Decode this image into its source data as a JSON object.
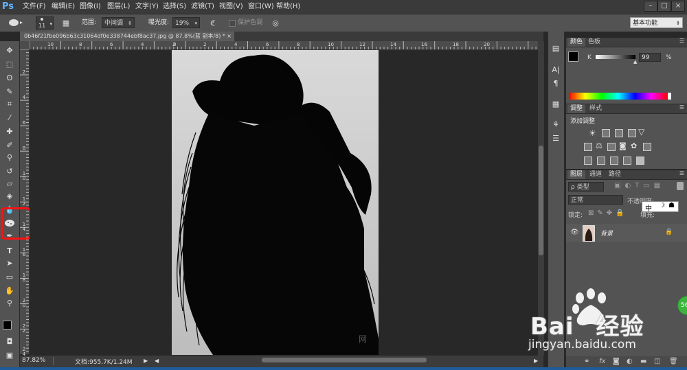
{
  "app": {
    "logo": "Ps"
  },
  "menu": [
    "文件(F)",
    "编辑(E)",
    "图像(I)",
    "图层(L)",
    "文字(Y)",
    "选择(S)",
    "滤镜(T)",
    "视图(V)",
    "窗口(W)",
    "帮助(H)"
  ],
  "window_buttons": [
    "–",
    "□",
    "×"
  ],
  "options": {
    "brush_size": "11",
    "range_label": "范围:",
    "range_value": "中间调",
    "exposure_label": "曝光度:",
    "exposure_value": "19%",
    "protect_label": "保护色调",
    "workspace": "基本功能"
  },
  "document": {
    "tab_title": "0b46f21fbe096b63c31064df0e338744ebf8ac37.jpg @ 87.8%(蓝 副本/8) *",
    "tab_close": "×",
    "zoom": "87.82%",
    "doc_info": "文档:955.7K/1.24M"
  },
  "ruler": {
    "top": [
      "10",
      "8",
      "6",
      "4",
      "2",
      "0",
      "2",
      "4",
      "6",
      "8",
      "10",
      "12",
      "14",
      "16",
      "18",
      "20"
    ],
    "left": [
      "2",
      "4",
      "6",
      "8",
      "1 0",
      "1 2",
      "1 4",
      "1 6",
      "1 8",
      "2 0",
      "2 2",
      "2 4"
    ]
  },
  "color_panel": {
    "tabs": [
      "颜色",
      "色板"
    ],
    "channel": "K",
    "value": "99",
    "unit": "%"
  },
  "adjust_panel": {
    "tabs": [
      "调整",
      "样式"
    ],
    "title": "添加调整"
  },
  "layers_panel": {
    "tabs": [
      "图层",
      "通道",
      "路径"
    ],
    "filter": "ρ 类型",
    "blend": "正常",
    "opacity_label": "不透明度:",
    "lock_label": "锁定:",
    "fill_label": "填充:",
    "layer_name": "背景",
    "ime": "中"
  },
  "watermark": {
    "brand": "Bai",
    "brand2": "经验",
    "url": "jingyan.baidu.com"
  },
  "badge": "56"
}
